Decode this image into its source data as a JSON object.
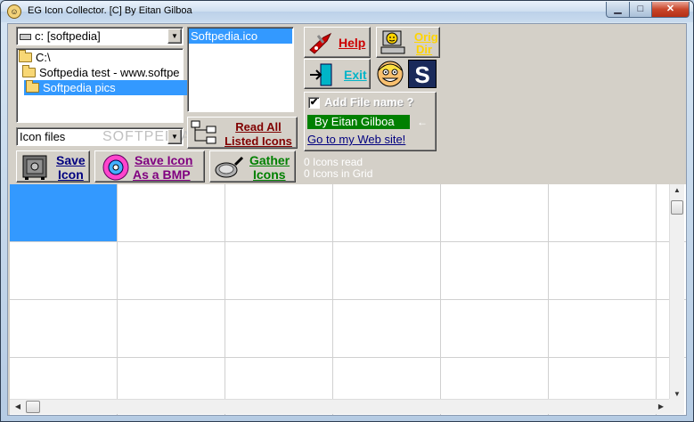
{
  "window": {
    "title": "EG Icon Collector.  [C]  By Eitan Gilboa"
  },
  "drive_combo": {
    "value": "c: [softpedia]"
  },
  "tree": {
    "items": [
      "C:\\",
      "Softpedia test - www.softpe",
      "Softpedia pics"
    ]
  },
  "file_list": {
    "items": [
      "Softpedia.ico"
    ]
  },
  "filter_combo": {
    "value": "Icon files"
  },
  "buttons": {
    "help": "Help",
    "orig_dir_line1": "Orig",
    "orig_dir_line2": "Dir",
    "exit": "Exit",
    "read_all_line1": "Read All",
    "read_all_line2": "Listed Icons",
    "save_icon_line1": "Save",
    "save_icon_line2": "Icon",
    "save_bmp_line1": "Save Icon",
    "save_bmp_line2": "As a  BMP",
    "gather_line1": "Gather",
    "gather_line2": "Icons"
  },
  "options": {
    "add_file_name_label": "Add File name ?",
    "add_file_name_checked": true,
    "author_label": "By Eitan Gilboa",
    "website_link": "Go to my Web site!"
  },
  "status": {
    "icons_read": "0 Icons read",
    "icons_in_grid": "0 Icons in Grid"
  },
  "watermark": "SOFTPEDIA",
  "logo_letter": "S",
  "colors": {
    "help": "#cc0000",
    "orig_dir": "#ffd400",
    "exit": "#00b4c8",
    "read_all": "#800000",
    "save_icon": "#000080",
    "save_bmp": "#800080",
    "gather": "#008000",
    "author_bg": "#008000",
    "selection": "#3399ff"
  },
  "grid": {
    "rows": 4,
    "cols": 7,
    "selected_cell": [
      0,
      0
    ]
  }
}
